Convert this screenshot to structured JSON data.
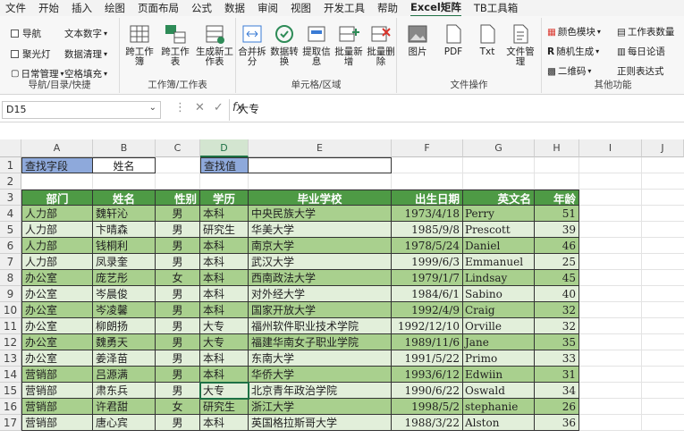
{
  "menu": [
    "文件",
    "开始",
    "插入",
    "绘图",
    "页面布局",
    "公式",
    "数据",
    "审阅",
    "视图",
    "开发工具",
    "帮助",
    "Excel矩阵",
    "TB工具箱"
  ],
  "active_tab_index": 11,
  "ribbon": {
    "nav_group": {
      "items": [
        "导航",
        "聚光灯",
        "日常管理",
        "文本数字",
        "数据清理",
        "空格填充"
      ],
      "label": "导航/目录/快捷"
    },
    "sheet_group": {
      "buttons": [
        "跨工作簿",
        "跨工作表",
        "生成新工作表"
      ],
      "label": "工作簿/工作表"
    },
    "cell_group": {
      "buttons": [
        "合并拆分",
        "数据转换",
        "提取信息",
        "批量新增",
        "批量删除"
      ],
      "label": "单元格/区域"
    },
    "file_group": {
      "buttons": [
        "图片",
        "PDF",
        "Txt",
        "文件管理"
      ],
      "label": "文件操作"
    },
    "other_group": {
      "items": [
        "颜色模块",
        "随机生成",
        "二维码",
        "工作表数量",
        "每日论语",
        "正则表达式"
      ],
      "label": "其他功能"
    }
  },
  "formula_bar": {
    "name_box": "D15",
    "value": "大专"
  },
  "columns": [
    "A",
    "B",
    "C",
    "D",
    "E",
    "F",
    "G",
    "H",
    "I",
    "J"
  ],
  "search": {
    "field_label": "查找字段",
    "field_value": "姓名",
    "value_label": "查找值",
    "value_input": ""
  },
  "table": {
    "headers": [
      "部门",
      "姓名",
      "性别",
      "学历",
      "毕业学校",
      "出生日期",
      "英文名",
      "年龄"
    ],
    "rows": [
      [
        "人力部",
        "魏轩沁",
        "男",
        "本科",
        "中央民族大学",
        "1973/4/18",
        "Perry",
        "51"
      ],
      [
        "人力部",
        "卞晴森",
        "男",
        "研究生",
        "华美大学",
        "1985/9/8",
        "Prescott",
        "39"
      ],
      [
        "人力部",
        "钱桐利",
        "男",
        "本科",
        "南京大学",
        "1978/5/24",
        "Daniel",
        "46"
      ],
      [
        "人力部",
        "凤录奎",
        "男",
        "本科",
        "武汉大学",
        "1999/6/3",
        "Emmanuel",
        "25"
      ],
      [
        "办公室",
        "庞艺彤",
        "女",
        "本科",
        "西南政法大学",
        "1979/1/7",
        "Lindsay",
        "45"
      ],
      [
        "办公室",
        "岑晨俊",
        "男",
        "本科",
        "对外经大学",
        "1984/6/1",
        "Sabino",
        "40"
      ],
      [
        "办公室",
        "岑凌馨",
        "男",
        "本科",
        "国家开放大学",
        "1992/4/9",
        "Craig",
        "32"
      ],
      [
        "办公室",
        "柳朗扬",
        "男",
        "大专",
        "福州软件职业技术学院",
        "1992/12/10",
        "Orville",
        "32"
      ],
      [
        "办公室",
        "魏勇天",
        "男",
        "大专",
        "福建华南女子职业学院",
        "1989/11/6",
        "Jane",
        "35"
      ],
      [
        "办公室",
        "姜泽苗",
        "男",
        "本科",
        "东南大学",
        "1991/5/22",
        "Primo",
        "33"
      ],
      [
        "营销部",
        "吕源满",
        "男",
        "本科",
        "华侨大学",
        "1993/6/12",
        "Edwiin",
        "31"
      ],
      [
        "营销部",
        "肃东兵",
        "男",
        "大专",
        "北京青年政治学院",
        "1990/6/22",
        "Oswald",
        "34"
      ],
      [
        "营销部",
        "许君甜",
        "女",
        "研究生",
        "浙江大学",
        "1998/5/2",
        "stephanie",
        "26"
      ],
      [
        "营销部",
        "唐心宾",
        "男",
        "本科",
        "英国格拉斯哥大学",
        "1988/3/22",
        "Alston",
        "36"
      ]
    ]
  },
  "colors": {
    "header_green": "#4e9a45",
    "band_dark": "#a9d08e",
    "band_light": "#e2efda",
    "label_blue": "#8ea9db",
    "accent": "#1e7145"
  }
}
